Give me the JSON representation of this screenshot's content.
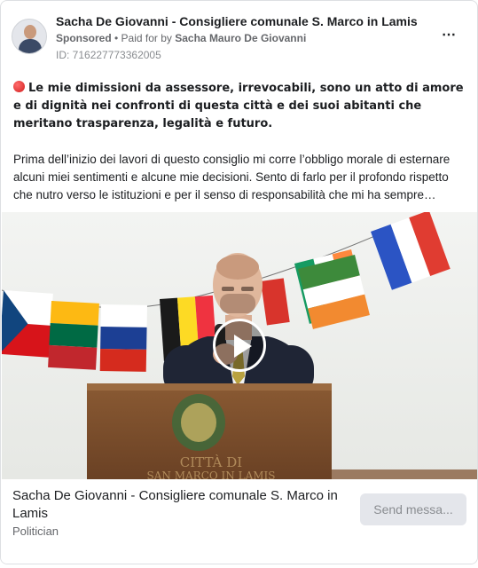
{
  "post": {
    "page_name": "Sacha De Giovanni - Consigliere comunale S. Marco in Lamis",
    "sponsored_label": "Sponsored",
    "separator": " • ",
    "paid_for_prefix": "Paid for by ",
    "payer": "Sacha Mauro De Giovanni",
    "ad_id": "ID: 716227773362005",
    "more_icon": "⋯",
    "headline": "Le mie dimissioni da assessore, irrevocabili, sono un atto di amore e di dignità nei confronti di questa città e dei suoi abitanti che meritano trasparenza, legalità e futuro.",
    "paragraph": "Prima dell’inizio dei lavori di questo consiglio mi corre l’obbligo morale di esternare alcuni miei sentimenti e alcune mie decisioni. Sento di farlo per il profondo rispetto che nutro verso le istituzioni e per il senso di responsabilità che mi ha sempre…"
  },
  "video": {
    "podium_text_1": "CITTÀ DI",
    "podium_text_2": "SAN MARCO IN LAMIS",
    "play_icon": "play-icon"
  },
  "footer": {
    "title": "Sacha De Giovanni - Consigliere comunale S. Marco in Lamis",
    "category": "Politician",
    "cta_label": "Send messa..."
  },
  "colors": {
    "accent_red": "#d21f1f",
    "cta_background": "#e4e6eb",
    "muted_text": "#65676b"
  }
}
